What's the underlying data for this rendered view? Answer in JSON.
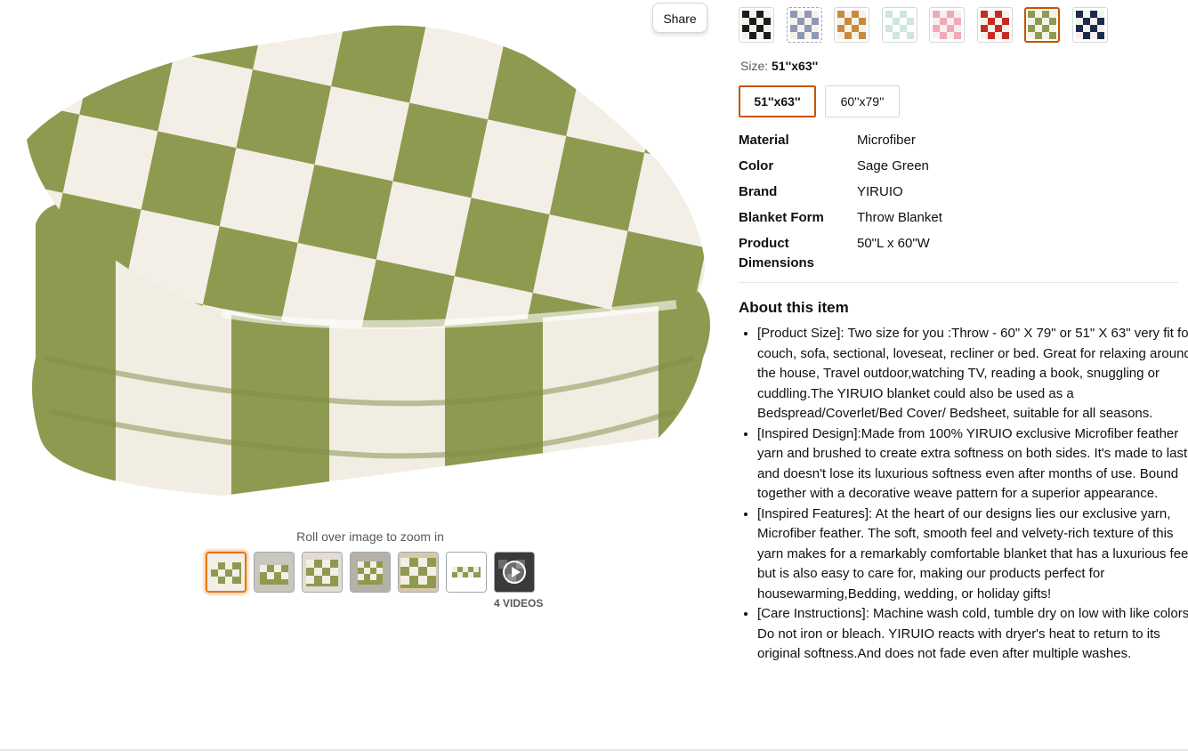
{
  "share_label": "Share",
  "zoom_hint": "Roll over image to zoom in",
  "videos_label": "4 VIDEOS",
  "thumbnails": [
    "blanket-folded",
    "blanket-couch",
    "blanket-chair",
    "blanket-room",
    "blanket-draped",
    "blanket-flat",
    "video"
  ],
  "swatches": [
    {
      "name": "black",
      "color": "#1c1c1c"
    },
    {
      "name": "grey-blue",
      "color": "#8e98b5"
    },
    {
      "name": "caramel",
      "color": "#c98a3e"
    },
    {
      "name": "mint",
      "color": "#cfe6da"
    },
    {
      "name": "pink",
      "color": "#f1a7be"
    },
    {
      "name": "red",
      "color": "#c62b22"
    },
    {
      "name": "sage",
      "color": "#8f9a51"
    },
    {
      "name": "navy",
      "color": "#1d2a4f"
    }
  ],
  "size": {
    "label": "Size:",
    "selected": "51''x63''",
    "options": [
      "51''x63''",
      "60''x79''"
    ]
  },
  "specs": [
    {
      "key": "Material",
      "value": "Microfiber"
    },
    {
      "key": "Color",
      "value": "Sage Green"
    },
    {
      "key": "Brand",
      "value": "YIRUIO"
    },
    {
      "key": "Blanket Form",
      "value": "Throw Blanket"
    },
    {
      "key": "Product Dimensions",
      "value": "50\"L x 60\"W"
    }
  ],
  "about": {
    "title": "About this item",
    "bullets": [
      "[Product Size]: Two size for you :Throw - 60\" X 79\" or 51\" X 63\" very fit for couch, sofa, sectional, loveseat, recliner or bed. Great for relaxing around the house, Travel outdoor,watching TV, reading a book, snuggling or cuddling.The YIRUIO blanket could also be used as a Bedspread/Coverlet/Bed Cover/ Bedsheet, suitable for all seasons.",
      "[Inspired Design]:Made from 100% YIRUIO exclusive Microfiber feather yarn and brushed to create extra softness on both sides. It's made to last and doesn't lose its luxurious softness even after months of use. Bound together with a decorative weave pattern for a superior appearance.",
      "[Inspired Features]: At the heart of our designs lies our exclusive yarn, Microfiber feather. The soft, smooth feel and velvety-rich texture of this yarn makes for a remarkably comfortable blanket that has a luxurious feel but is also easy to care for, making our products perfect for housewarming,Bedding, wedding, or holiday gifts!",
      "[Care Instructions]: Machine wash cold, tumble dry on low with like colors. Do not iron or bleach. YIRUIO reacts with dryer's heat to return to its original softness.And does not fade even after multiple washes."
    ]
  }
}
